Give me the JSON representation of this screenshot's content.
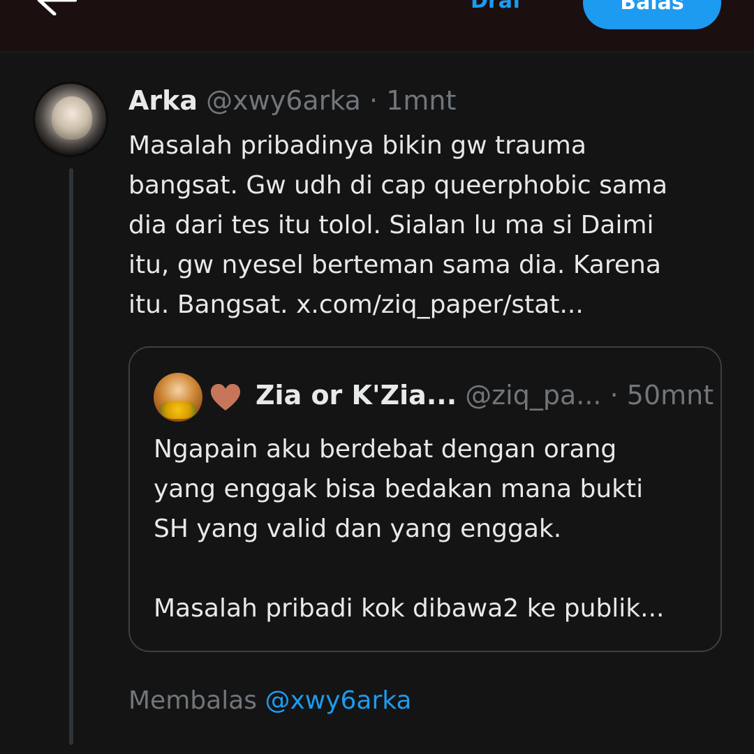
{
  "topbar": {
    "draft_label": "Draf",
    "reply_label": "Balas"
  },
  "tweet": {
    "display_name": "Arka",
    "handle": "@xwy6arka",
    "separator": "·",
    "time": "1mnt",
    "body": "Masalah pribadinya bikin gw trauma\nbangsat. Gw udh di cap queerphobic sama\ndia dari tes itu tolol. Sialan lu ma si Daimi\nitu, gw nyesel berteman sama dia. Karena\nitu. Bangsat. x.com/ziq_paper/stat..."
  },
  "quote": {
    "display_name": "Zia or K'Zia...",
    "handle": "@ziq_pa...",
    "separator": "·",
    "time": "50mnt",
    "body": "Ngapain aku berdebat dengan orang\nyang enggak bisa bedakan mana bukti\nSH yang valid dan yang enggak.\n\nMasalah pribadi kok dibawa2 ke publik..."
  },
  "replying": {
    "label": "Membalas",
    "handle": "@xwy6arka"
  },
  "colors": {
    "accent": "#1d9bf0",
    "background": "#141414",
    "text_primary": "#e7e9ea",
    "text_secondary": "#71767b",
    "heart": "#c8765a"
  },
  "icons": {
    "back": "back-arrow-icon",
    "heart": "heart-icon"
  }
}
